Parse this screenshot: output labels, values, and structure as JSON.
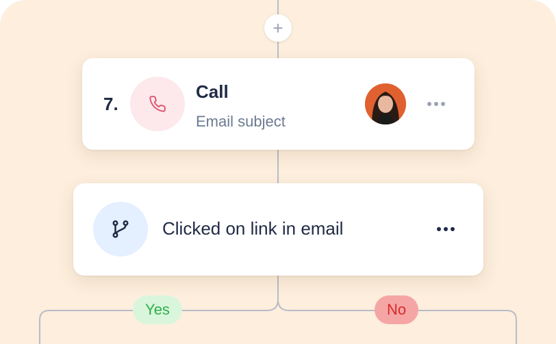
{
  "workflow": {
    "add_step_label": "+",
    "call_step": {
      "number": "7.",
      "title": "Call",
      "subtitle": "Email subject",
      "icon": "phone-icon",
      "avatar": "person-avatar"
    },
    "condition_step": {
      "label": "Clicked on link in email",
      "icon": "branch-icon"
    },
    "branches": {
      "yes_label": "Yes",
      "no_label": "No"
    }
  },
  "colors": {
    "canvas_background": "#fdeedd",
    "connector": "#b8bcc8",
    "text_primary": "#1f2a44",
    "text_secondary": "#6b7a90",
    "call_icon_bg": "#fde8ec",
    "call_icon": "#e0566e",
    "branch_icon_bg": "#e4efff",
    "yes_bg": "#d9f6dc",
    "yes_text": "#2eb04a",
    "no_bg": "#f6a5a5",
    "no_text": "#d62b2b"
  }
}
